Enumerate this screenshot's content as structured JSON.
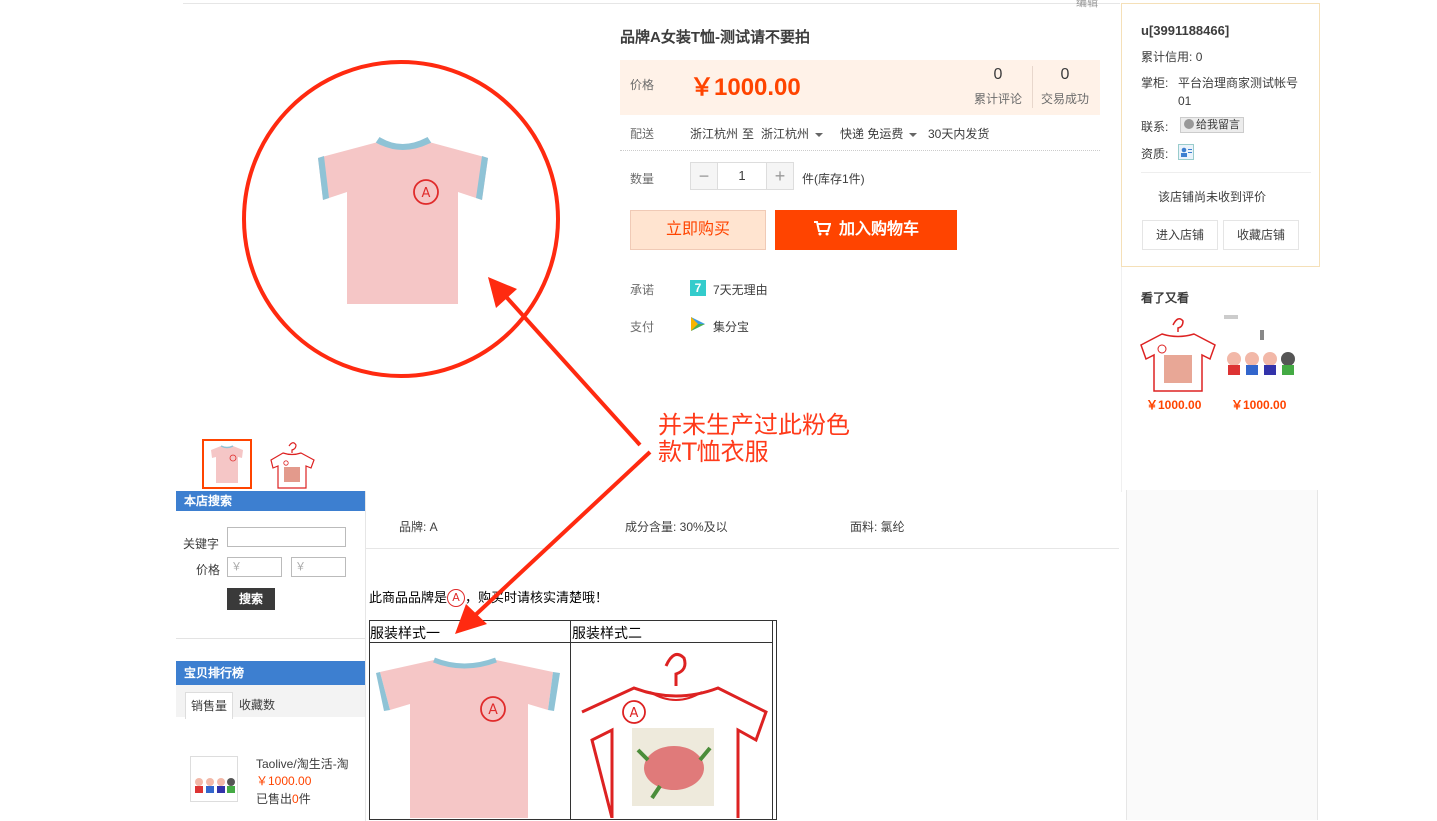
{
  "page": {
    "edit_link": "编辑"
  },
  "product": {
    "title": "品牌A女装T恤-测试请不要拍",
    "price_label": "价格",
    "price": "￥1000.00",
    "reviews_count": "0",
    "reviews_label": "累计评论",
    "deals_count": "0",
    "deals_label": "交易成功",
    "shipping_label": "配送",
    "ship_from": "浙江杭州",
    "ship_to_word": "至",
    "ship_to": "浙江杭州",
    "ship_method": "快递 免运费",
    "ship_time": "30天内发货",
    "qty_label": "数量",
    "qty_value": "1",
    "qty_minus": "−",
    "qty_plus": "+",
    "stock": "件(库存1件)",
    "buy_now": "立即购买",
    "add_cart": "加入购物车",
    "promise_label": "承诺",
    "promise_icon_text": "7",
    "promise_text": "7天无理由",
    "pay_label": "支付",
    "pay_text": "集分宝"
  },
  "seller": {
    "name": "u[3991188466]",
    "credit_label": "累计信用:",
    "credit_value": "0",
    "keeper_label": "掌柜:",
    "keeper_line1": "平台治理商家测试帐号",
    "keeper_line2": "01",
    "contact_label": "联系:",
    "contact_btn": "给我留言",
    "qual_label": "资质:",
    "no_review": "该店铺尚未收到评价",
    "enter_shop": "进入店铺",
    "fav_shop": "收藏店铺"
  },
  "also_viewed": {
    "title": "看了又看",
    "items": [
      {
        "price": "￥1000.00"
      },
      {
        "price": "￥1000.00"
      }
    ]
  },
  "sidebar": {
    "search_title": "本店搜索",
    "keyword_label": "关键字",
    "price_label": "价格",
    "price_min_ph": "￥",
    "price_max_ph": "￥",
    "search_btn": "搜索",
    "rank_title": "宝贝排行榜",
    "tab_sales": "销售量",
    "tab_fav": "收藏数",
    "rank_item": {
      "name": "Taolive/淘生活-淘",
      "price": "￥1000.00",
      "sold_prefix": "已售出",
      "sold_count": "0",
      "sold_suffix": "件"
    }
  },
  "attributes": {
    "brand": "品牌: A",
    "composition": "成分含量: 30%及以",
    "fabric": "面料: 氯纶"
  },
  "description": {
    "line_prefix": "此商品品牌是",
    "logo_letter": "A",
    "line_suffix": "，购买时请核实清楚哦！",
    "col1": "服装样式一",
    "col2": "服装样式二"
  },
  "annotation": {
    "line1": "并未生产过此粉色",
    "line2": "款T恤衣服"
  },
  "colors": {
    "accent": "#ff4400",
    "annotation": "#ff3a1a",
    "shirt_pink": "#f5c6c6",
    "shirt_trim": "#8fc3d6",
    "sidebar_blue": "#3d7fd0"
  }
}
